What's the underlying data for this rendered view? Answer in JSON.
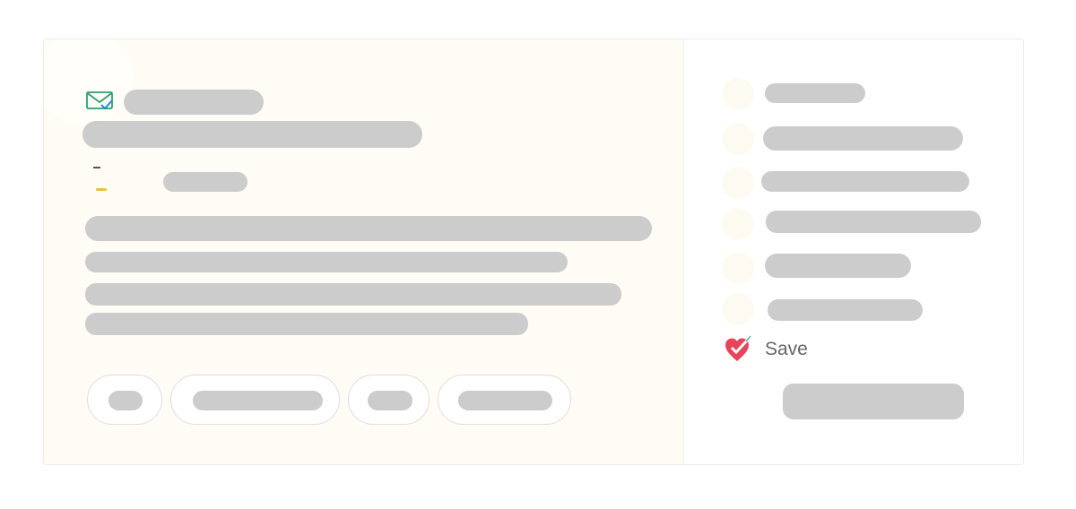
{
  "save": {
    "label": "Save"
  },
  "icons": {
    "mail": "mail-check-icon",
    "heart": "heart-check-icon"
  },
  "colors": {
    "mail_icon": "#2f9e6a",
    "heart": "#e8455a",
    "skeleton": "#cccccc",
    "panel_bg": "#fefcf5"
  }
}
